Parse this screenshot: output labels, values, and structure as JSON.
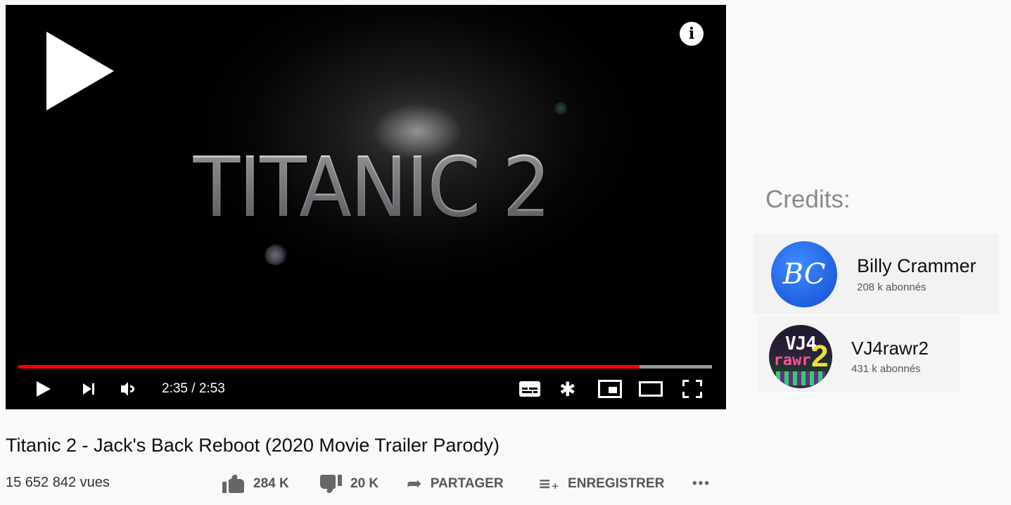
{
  "player": {
    "overlay_title": "TITANIC 2",
    "time_current": "2:35",
    "time_total": "2:53",
    "time_display": "2:35 / 2:53",
    "progress_fraction": 0.896,
    "progress_color": "#ff0000"
  },
  "video": {
    "title": "Titanic 2 - Jack's Back Reboot (2020 Movie Trailer Parody)",
    "views": "15 652 842 vues"
  },
  "actions": {
    "like_count": "284 K",
    "dislike_count": "20 K",
    "share_label": "PARTAGER",
    "save_label": "ENREGISTRER",
    "more_label": "•••"
  },
  "credits": {
    "heading": "Credits:",
    "people": [
      {
        "name": "Billy Crammer",
        "subscribers": "208 k abonnés",
        "avatar_text": "BC",
        "avatar_color": "#2b6ff0"
      },
      {
        "name": "VJ4rawr2",
        "subscribers": "431 k abonnés"
      }
    ]
  },
  "icons": {
    "info": "i",
    "settings": "✱"
  }
}
